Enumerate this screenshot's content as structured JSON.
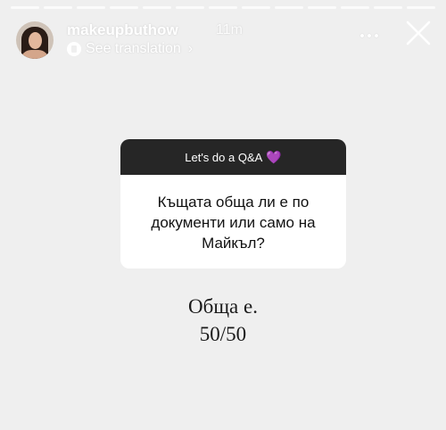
{
  "story": {
    "username": "makeupbuthow",
    "timestamp": "11m",
    "see_translation": "See translation",
    "segments": 13
  },
  "question_sticker": {
    "title": "Let's do a Q&A",
    "emoji": "💜",
    "question": "Къщата обща ли е по документи или само на Майкъл?"
  },
  "answer": {
    "line1": "Обща е.",
    "line2": "50/50"
  },
  "icons": {
    "translate": "translate-icon",
    "chevron": "chevron-right-icon",
    "more": "more-icon",
    "close": "close-icon"
  },
  "colors": {
    "background": "#efefef",
    "sticker_header": "#262626",
    "sticker_body": "#ffffff",
    "heart": "#e35bd3"
  }
}
